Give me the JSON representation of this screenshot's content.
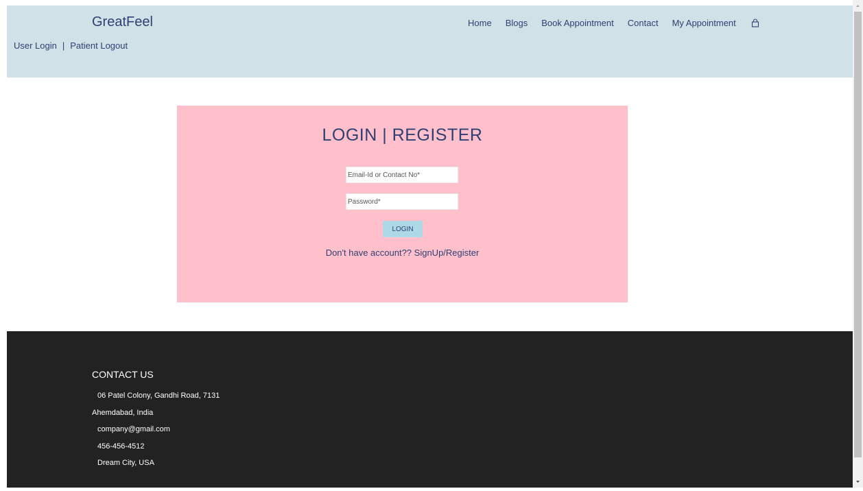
{
  "header": {
    "brand": "GreatFeel",
    "user_login": "User Login",
    "separator": "|",
    "patient_logout": "Patient Logout",
    "nav": [
      "Home",
      "Blogs",
      "Book Appointment",
      "Contact",
      "My Appointment"
    ],
    "cart_icon": "shopping-bag-icon"
  },
  "login": {
    "title": "LOGIN | REGISTER",
    "email_placeholder": "Email-Id or Contact No*",
    "password_placeholder": "Password*",
    "button_label": "LOGIN",
    "signup_prefix": "Don't have account?? ",
    "signup_link": "SignUp/Register"
  },
  "footer": {
    "title": "CONTACT US",
    "address_line1": "06 Patel Colony, Gandhi Road, 7131",
    "address_line2": "Ahemdabad, India",
    "email": "company@gmail.com",
    "phone": "456-456-4512",
    "city": "Dream City, USA"
  },
  "colors": {
    "header_bg": "#d0e1e8",
    "card_bg": "#ffc0cb",
    "button_bg": "#add8e6",
    "footer_bg": "#222222",
    "text_navy": "#2e3f73"
  }
}
